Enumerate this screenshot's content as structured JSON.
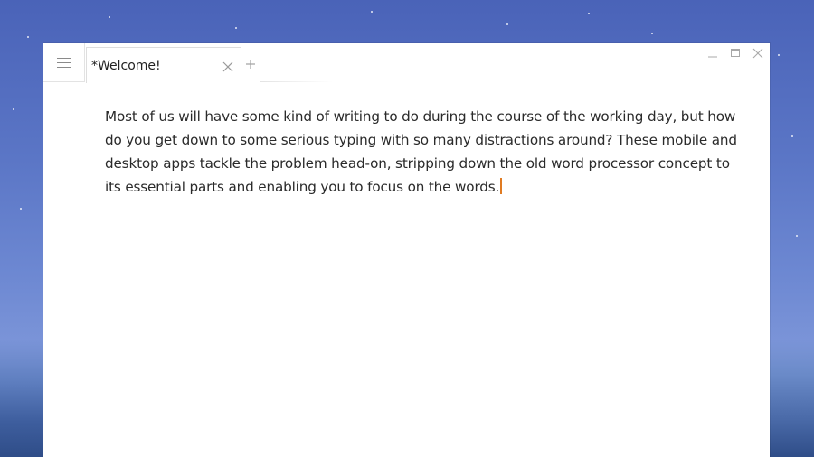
{
  "window": {
    "tab": {
      "label": "*Welcome!"
    },
    "new_tab_symbol": "+"
  },
  "icons": {
    "menu": "hamburger-menu-icon",
    "tab_close": "close-icon",
    "new_tab": "plus-icon",
    "minimize": "minimize-icon",
    "maximize": "maximize-icon",
    "close": "close-icon"
  },
  "editor": {
    "text": "Most of us will have some kind of writing to do during the course of the working day, but how do you get down to some serious typing with so many distractions around? These mobile and desktop apps tackle the problem head-on, stripping down the old word processor concept to its essential parts and enabling you to focus on the words."
  },
  "colors": {
    "background": "#5b76c6",
    "window": "#ffffff",
    "caret": "#e07b22",
    "text": "#2a2a2a"
  }
}
